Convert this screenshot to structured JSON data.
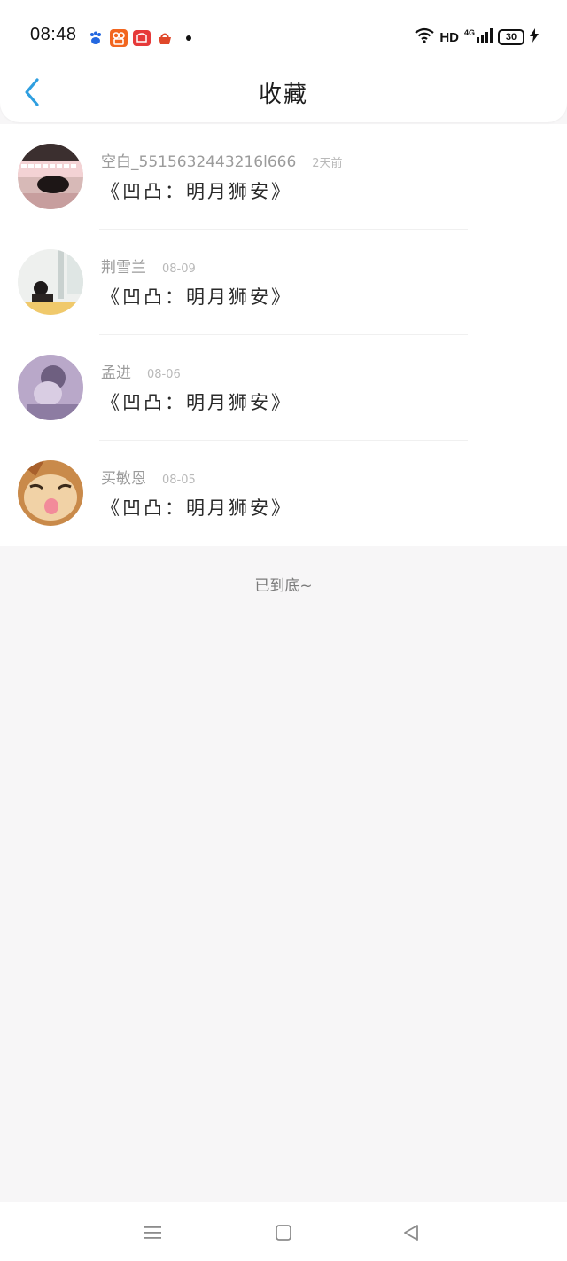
{
  "status_bar": {
    "time": "08:48",
    "hd": "HD",
    "network": "4G",
    "battery": "30",
    "notification_icons": [
      "baidu-paw-icon",
      "kuaishou-icon",
      "gift-app-icon",
      "basket-app-icon"
    ]
  },
  "title_bar": {
    "title": "收藏",
    "back_icon": "chevron-left-icon",
    "accent_color": "#2f9fe0"
  },
  "items": [
    {
      "name": "空白_5515632443216l666",
      "time": "2天前",
      "content": "《凹凸：明月狮安》"
    },
    {
      "name": "荆雪兰",
      "time": "08-09",
      "content": "《凹凸：明月狮安》"
    },
    {
      "name": "孟进",
      "time": "08-06",
      "content": "《凹凸：明月狮安》"
    },
    {
      "name": "买敏恩",
      "time": "08-05",
      "content": "《凹凸：明月狮安》"
    }
  ],
  "footer": {
    "end_text": "已到底~"
  },
  "nav_bar": {
    "icons": [
      "menu-icon",
      "home-icon",
      "back-triangle-icon"
    ]
  }
}
